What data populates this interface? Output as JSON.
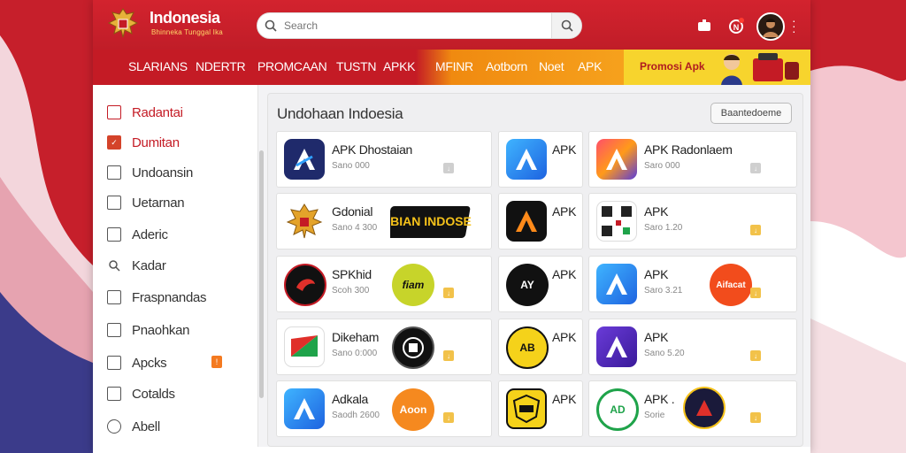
{
  "app": {
    "brand_title": "Indonesia",
    "brand_subtitle": "Bhinneka Tunggal Ika"
  },
  "search": {
    "placeholder": "Search",
    "value": ""
  },
  "nav": {
    "items": [
      "SLARIANS",
      "NDERTR",
      "PROMCAAN",
      "TUSTN",
      "APKK",
      "MFINR",
      "Aotborn",
      "Noet",
      "APK"
    ],
    "promo_text": "Promosi Apk"
  },
  "sidebar": {
    "items": [
      {
        "label": "Radantai"
      },
      {
        "label": "Dumitan"
      },
      {
        "label": "Undoansin"
      },
      {
        "label": "Uetarnan"
      },
      {
        "label": "Aderic"
      },
      {
        "label": "Kadar"
      },
      {
        "label": "Fraspnandas"
      },
      {
        "label": "Pnaohkan"
      },
      {
        "label": "Apcks",
        "badge": "!"
      },
      {
        "label": "Cotalds"
      },
      {
        "label": "Abell"
      }
    ]
  },
  "content": {
    "title": "Undohaan Indoesia",
    "action_button": "Baantedoeme"
  },
  "apps": [
    {
      "title": "APK Dhostaian",
      "size": "Sano 000"
    },
    {
      "title": "APK",
      "size": ""
    },
    {
      "title": "APK Radonlaem",
      "size": "Saro 000"
    },
    {
      "title": "Gdonial",
      "size": "Sano 4 300"
    },
    {
      "title": "APK",
      "size": ""
    },
    {
      "title": "APK",
      "size": "Saro 1.20"
    },
    {
      "title": "SPKhid",
      "size": "Scoh 300"
    },
    {
      "title": "APK",
      "size": ""
    },
    {
      "title": "APK",
      "size": "Saro 3.21"
    },
    {
      "title": "Dikeham",
      "size": "Sano 0:000"
    },
    {
      "title": "APK",
      "size": ""
    },
    {
      "title": "APK",
      "size": "Sano 5.20"
    },
    {
      "title": "Adkala",
      "size": "Saodh 2600"
    },
    {
      "title": "APK",
      "size": ""
    },
    {
      "title": "APK .",
      "size": "Sorie"
    }
  ],
  "badges": {
    "banner_text": "BIAN INDOSE",
    "fiam_text": "fiam",
    "aifacat_text": "Aifacat",
    "aoon_text": "Aoon",
    "ad_text": "AD",
    "ab_text": "AB",
    "ay_text": "AY"
  },
  "colors": {
    "topbar": "#c61f2b",
    "accent": "#d4432a",
    "promo": "#f7d42d"
  }
}
